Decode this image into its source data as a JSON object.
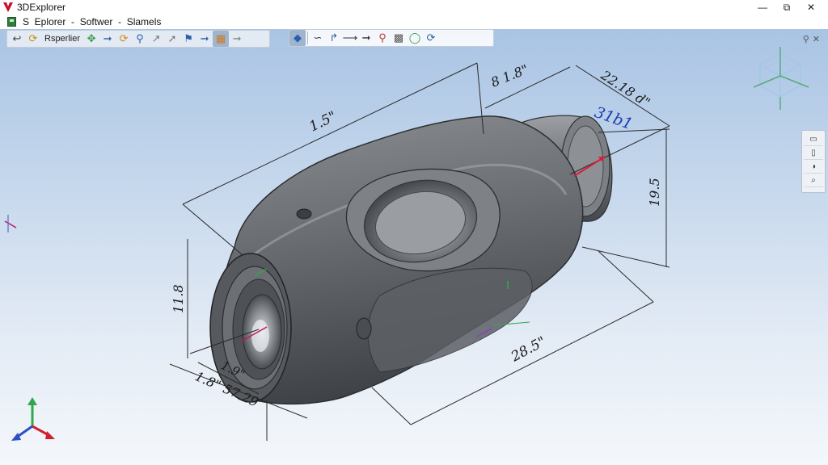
{
  "window": {
    "title": "3DExplorer",
    "breadcrumb": "S  Eplorer  -  Softwer  -  Slamels",
    "controls": {
      "minimize": "—",
      "maximize": "⧉",
      "close": "✕"
    }
  },
  "toolbar_left": {
    "properties_label": "Rsperlier",
    "buttons": [
      "back-arrow-icon",
      "orbit-icon",
      "pan-icon",
      "arrow-right-icon",
      "rotate-icon",
      "zoom-icon",
      "measure-icon",
      "arrow-icon",
      "flag-icon",
      "arrow-right-icon",
      "section-icon",
      "arrow-right-icon"
    ]
  },
  "toolbar_right": {
    "buttons": [
      "view-cube-icon",
      "curve-icon",
      "step-icon",
      "axis-icon",
      "pin-icon",
      "arrow-icon",
      "clamp-icon",
      "probe-icon",
      "rotate-arrow-icon"
    ]
  },
  "side_panel": {
    "buttons": [
      "▭",
      "▯",
      "◑",
      "⌕"
    ]
  },
  "dimensions": {
    "overall_length": "1.5\"",
    "top_right_label": "8 1.8\"",
    "shaft_length": "22.18 d\"",
    "callout": "31b1",
    "shaft_height": "19.5",
    "left_height": "11.8",
    "front_width": "1.9\"",
    "bottom_combo": "1.8\" 57.29",
    "body_length": "28.5\""
  },
  "colors": {
    "accent": "#2d5fa8",
    "callout": "#1c3db3",
    "callout_arrow": "#d91c3a",
    "part_fill": "#6d7075",
    "part_dark": "#3e4146"
  }
}
